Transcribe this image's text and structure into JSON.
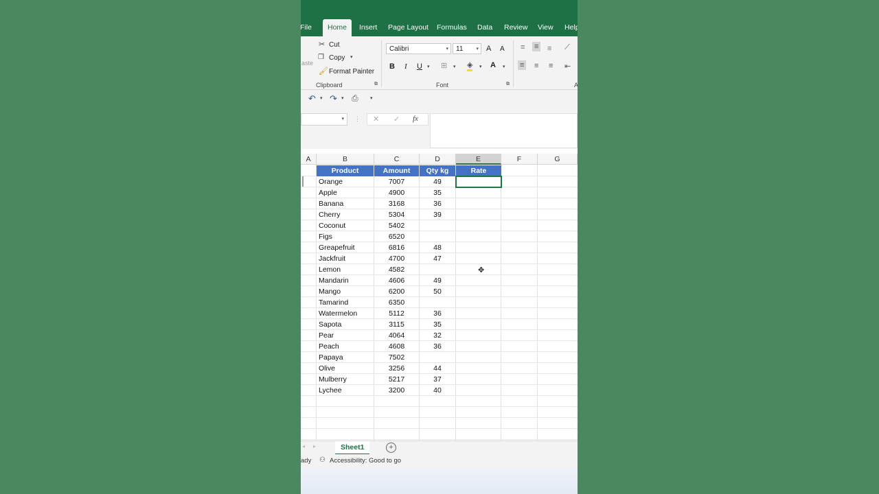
{
  "ribbon": {
    "tabs": [
      "File",
      "Home",
      "Insert",
      "Page Layout",
      "Formulas",
      "Data",
      "Review",
      "View",
      "Help"
    ],
    "active_tab": "Home",
    "clipboard": {
      "paste_label": "aste",
      "cut_label": "Cut",
      "copy_label": "Copy",
      "format_painter_label": "Format Painter",
      "group_label": "Clipboard"
    },
    "font": {
      "font_name": "Calibri",
      "font_size": "11",
      "bold": "B",
      "italic": "I",
      "underline": "U",
      "grow": "A",
      "shrink": "A",
      "font_color": "A",
      "group_label": "Font"
    },
    "alignment_group_label": "A"
  },
  "formula_bar": {
    "fx_label": "fx",
    "value": ""
  },
  "columns": [
    "A",
    "B",
    "C",
    "D",
    "E",
    "F",
    "G"
  ],
  "selected_column": "E",
  "table": {
    "headers": [
      "Product",
      "Amount",
      "Qty kg",
      "Rate"
    ],
    "rows": [
      {
        "product": "Orange",
        "amount": "7007",
        "qty": "49"
      },
      {
        "product": "Apple",
        "amount": "4900",
        "qty": "35"
      },
      {
        "product": "Banana",
        "amount": "3168",
        "qty": "36"
      },
      {
        "product": "Cherry",
        "amount": "5304",
        "qty": "39"
      },
      {
        "product": "Coconut",
        "amount": "5402",
        "qty": ""
      },
      {
        "product": "Figs",
        "amount": "6520",
        "qty": ""
      },
      {
        "product": "Greapefruit",
        "amount": "6816",
        "qty": "48"
      },
      {
        "product": "Jackfruit",
        "amount": "4700",
        "qty": "47"
      },
      {
        "product": "Lemon",
        "amount": "4582",
        "qty": ""
      },
      {
        "product": "Mandarin",
        "amount": "4606",
        "qty": "49"
      },
      {
        "product": "Mango",
        "amount": "6200",
        "qty": "50"
      },
      {
        "product": "Tamarind",
        "amount": "6350",
        "qty": ""
      },
      {
        "product": "Watermelon",
        "amount": "5112",
        "qty": "36"
      },
      {
        "product": "Sapota",
        "amount": "3115",
        "qty": "35"
      },
      {
        "product": "Pear",
        "amount": "4064",
        "qty": "32"
      },
      {
        "product": "Peach",
        "amount": "4608",
        "qty": "36"
      },
      {
        "product": "Papaya",
        "amount": "7502",
        "qty": ""
      },
      {
        "product": "Olive",
        "amount": "3256",
        "qty": "44"
      },
      {
        "product": "Mulberry",
        "amount": "5217",
        "qty": "37"
      },
      {
        "product": "Lychee",
        "amount": "3200",
        "qty": "40"
      }
    ]
  },
  "sheet_tabs": [
    "Sheet1"
  ],
  "status": {
    "ready": "ady",
    "accessibility": "Accessibility: Good to go"
  },
  "colors": {
    "excel_green": "#1e7145",
    "header_blue": "#4472c4",
    "background_green": "#4a8860"
  }
}
